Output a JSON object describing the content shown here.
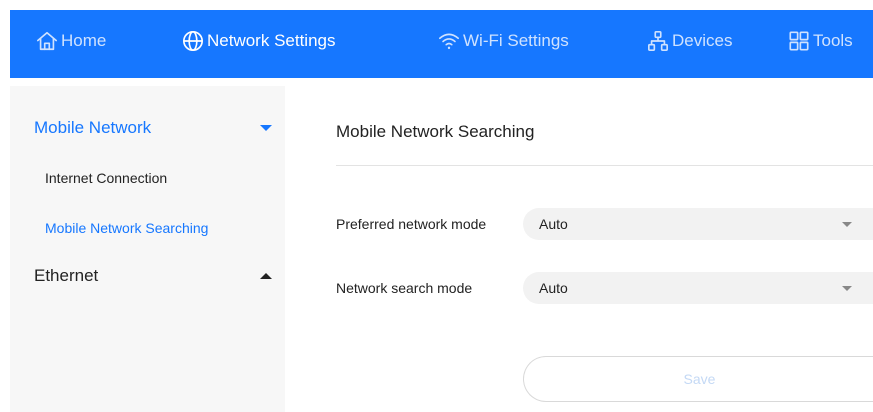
{
  "nav": {
    "home_label": "Home",
    "network_settings_label": "Network Settings",
    "wifi_settings_label": "Wi-Fi Settings",
    "devices_label": "Devices",
    "tools_label": "Tools",
    "active_item": "Network Settings"
  },
  "sidebar": {
    "groups": [
      {
        "label": "Mobile Network",
        "expanded": true,
        "items": [
          {
            "label": "Internet Connection",
            "selected": false
          },
          {
            "label": "Mobile Network Searching",
            "selected": true
          }
        ]
      },
      {
        "label": "Ethernet",
        "expanded": false
      }
    ]
  },
  "main": {
    "title": "Mobile Network Searching",
    "fields": [
      {
        "label": "Preferred network mode",
        "value": "Auto"
      },
      {
        "label": "Network search mode",
        "value": "Auto"
      }
    ],
    "save_label": "Save",
    "save_enabled": false
  },
  "colors": {
    "accent": "#1677ff",
    "nav_inactive_text": "#cfe2ff",
    "sidebar_bg": "#f7f7f7",
    "select_bg": "#f2f2f2",
    "disabled_button_text": "#c4d9f5"
  },
  "icons": {
    "home": "home-icon",
    "network_settings": "globe-icon",
    "wifi_settings": "wifi-icon",
    "devices": "device-network-icon",
    "tools": "grid-icon"
  }
}
